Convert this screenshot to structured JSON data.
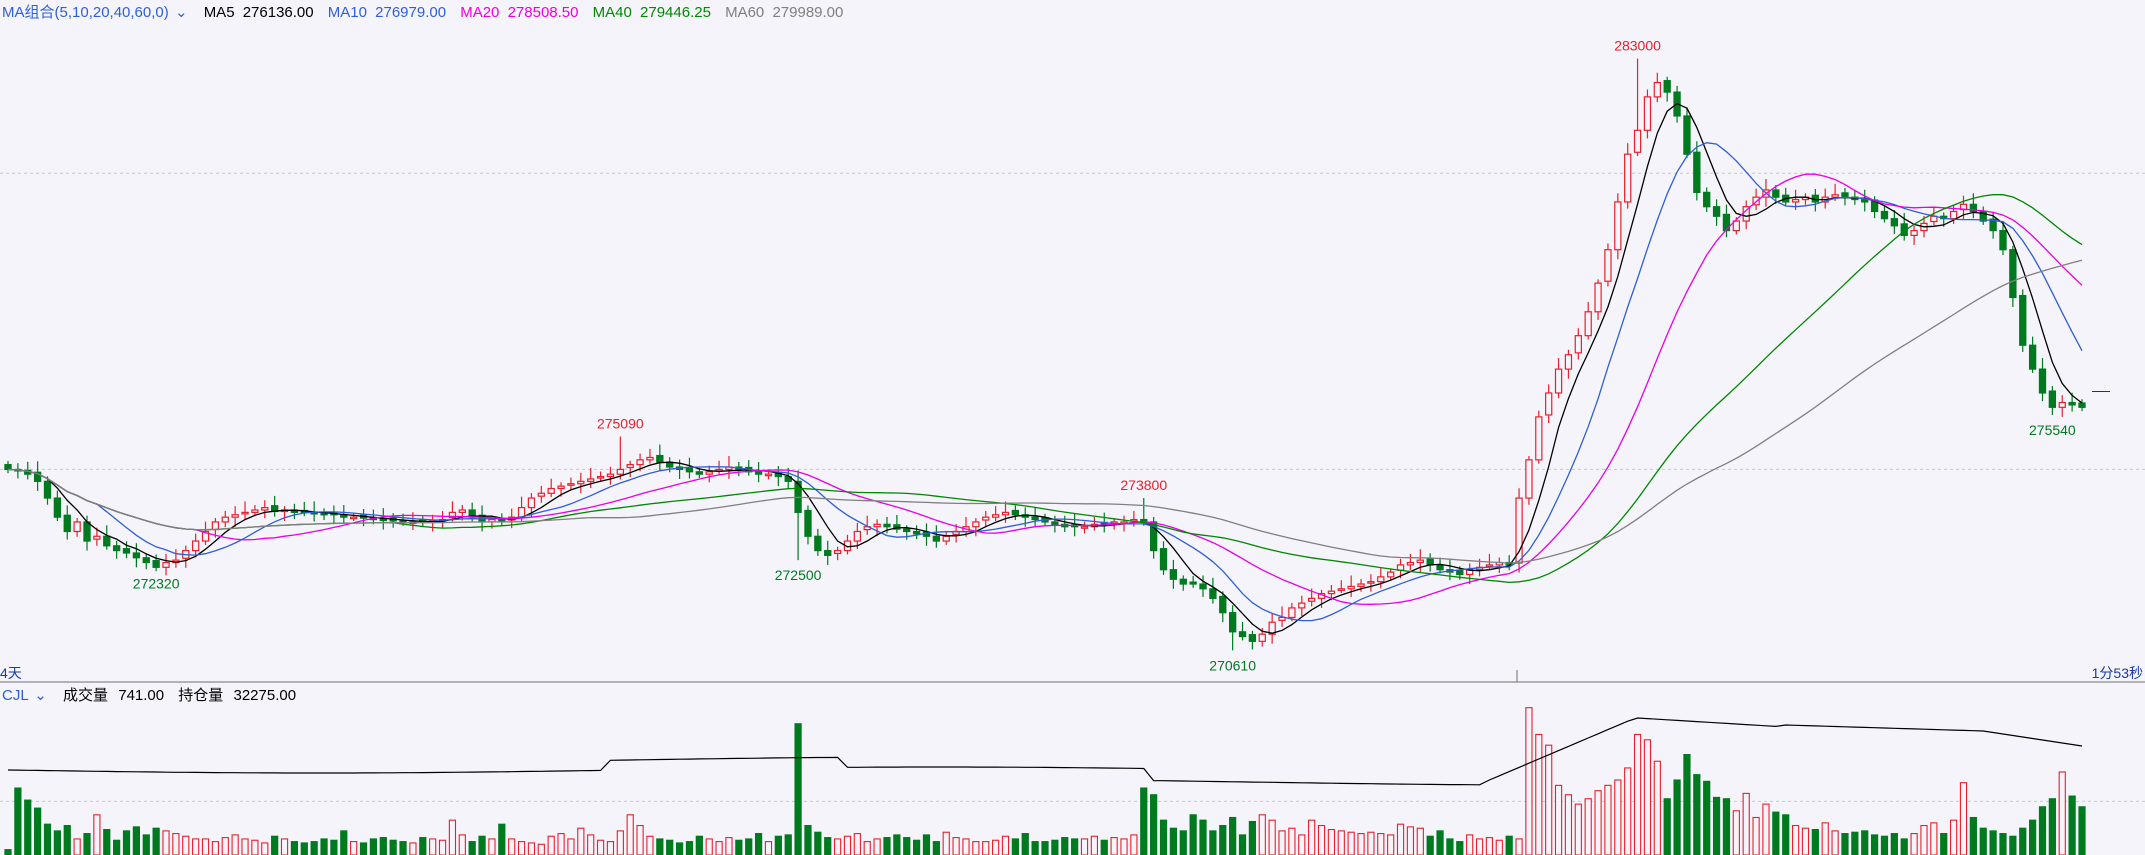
{
  "legend": {
    "ma_selector": "MA组合(5,10,20,40,60,0)",
    "items": [
      {
        "label": "MA5",
        "value": "276136.00",
        "color": "#000000"
      },
      {
        "label": "MA10",
        "value": "276979.00",
        "color": "#2f5fd8"
      },
      {
        "label": "MA20",
        "value": "278508.50",
        "color": "#e800e8"
      },
      {
        "label": "MA40",
        "value": "279446.25",
        "color": "#008800"
      },
      {
        "label": "MA60",
        "value": "279989.00",
        "color": "#808080"
      }
    ]
  },
  "axis": {
    "left_label": "4天",
    "right_label": "1分53秒"
  },
  "volume_legend": {
    "indicator": "CJL",
    "volume_label": "成交量",
    "volume_value": "741.00",
    "oi_label": "持仓量",
    "oi_value": "32275.00"
  },
  "colors": {
    "up": "#e8202a",
    "down": "#007a1f",
    "background": "#f4f4fa",
    "grid": "#c8c8c8"
  },
  "chart_data": {
    "type": "candlestick",
    "price_range": [
      270200,
      283600
    ],
    "annotations": [
      {
        "label": "275090",
        "value": 275090,
        "kind": "high",
        "index": 62,
        "color": "#e8202a"
      },
      {
        "label": "273800",
        "value": 273800,
        "kind": "high",
        "index": 115,
        "color": "#e8202a"
      },
      {
        "label": "283000",
        "value": 283000,
        "kind": "high",
        "index": 165,
        "color": "#e8202a"
      },
      {
        "label": "272320",
        "value": 272320,
        "kind": "low",
        "index": 15,
        "color": "#007a1f"
      },
      {
        "label": "272500",
        "value": 272500,
        "kind": "low",
        "index": 80,
        "color": "#007a1f"
      },
      {
        "label": "270610",
        "value": 270610,
        "kind": "low",
        "index": 124,
        "color": "#007a1f"
      },
      {
        "label": "275540",
        "value": 275540,
        "kind": "low",
        "index": 207,
        "color": "#007a1f"
      }
    ],
    "close": [
      274400,
      274380,
      274300,
      274150,
      273800,
      273400,
      273100,
      273300,
      272900,
      273000,
      272800,
      272700,
      272650,
      272550,
      272450,
      272350,
      272450,
      272500,
      272700,
      272900,
      273100,
      273300,
      273400,
      273450,
      273500,
      273550,
      273600,
      273520,
      273550,
      273500,
      273500,
      273480,
      273450,
      273450,
      273400,
      273400,
      273380,
      273360,
      273340,
      273320,
      273300,
      273300,
      273300,
      273320,
      273350,
      273500,
      273550,
      273400,
      273300,
      273350,
      273300,
      273400,
      273600,
      273800,
      273900,
      274000,
      274050,
      274100,
      274150,
      274200,
      274250,
      274300,
      274400,
      274500,
      274600,
      274650,
      274550,
      274450,
      274400,
      274350,
      274300,
      274350,
      274400,
      274450,
      274400,
      274350,
      274300,
      274300,
      274250,
      274150,
      273500,
      273000,
      272700,
      272600,
      272700,
      272900,
      273100,
      273200,
      273250,
      273200,
      273150,
      273100,
      273050,
      273000,
      272900,
      273000,
      273100,
      273200,
      273300,
      273400,
      273450,
      273500,
      273450,
      273400,
      273350,
      273300,
      273250,
      273200,
      273200,
      273200,
      273250,
      273250,
      273300,
      273300,
      273350,
      273300,
      272700,
      272300,
      272100,
      272000,
      272000,
      271900,
      271700,
      271400,
      271000,
      270900,
      270800,
      270950,
      271200,
      271300,
      271500,
      271600,
      271700,
      271800,
      271850,
      271900,
      271950,
      272000,
      272050,
      272150,
      272250,
      272400,
      272450,
      272500,
      272400,
      272300,
      272250,
      272200,
      272300,
      272350,
      272400,
      272450,
      272400,
      273800,
      274600,
      275500,
      276000,
      276500,
      276800,
      277200,
      277700,
      278300,
      279000,
      280000,
      281000,
      281500,
      282200,
      282500,
      282300,
      281800,
      281000,
      280200,
      279900,
      279700,
      279400,
      279600,
      279900,
      280100,
      280250,
      280100,
      280000,
      280050,
      280100,
      280000,
      280100,
      280150,
      280100,
      280050,
      280000,
      279800,
      279650,
      279500,
      279300,
      279400,
      279550,
      279700,
      279650,
      279800,
      279950,
      279800,
      279600,
      279400,
      279000,
      278000,
      277000,
      276500,
      276000,
      275700,
      275800,
      275750,
      275700
    ],
    "volume": [
      40,
      500,
      410,
      350,
      230,
      180,
      220,
      120,
      160,
      300,
      190,
      110,
      180,
      210,
      150,
      200,
      180,
      160,
      140,
      120,
      120,
      100,
      130,
      150,
      120,
      110,
      90,
      140,
      120,
      100,
      90,
      100,
      120,
      110,
      180,
      100,
      90,
      120,
      130,
      110,
      100,
      90,
      130,
      120,
      110,
      260,
      150,
      100,
      140,
      120,
      230,
      120,
      100,
      90,
      80,
      140,
      160,
      120,
      200,
      150,
      110,
      100,
      180,
      300,
      220,
      140,
      120,
      110,
      90,
      100,
      140,
      120,
      100,
      130,
      110,
      120,
      160,
      100,
      140,
      150,
      980,
      220,
      170,
      130,
      120,
      140,
      160,
      100,
      120,
      130,
      150,
      130,
      110,
      150,
      100,
      170,
      130,
      120,
      100,
      100,
      110,
      140,
      120,
      160,
      100,
      100,
      110,
      130,
      120,
      120,
      140,
      110,
      130,
      120,
      150,
      500,
      450,
      260,
      200,
      180,
      300,
      260,
      180,
      220,
      280,
      150,
      250,
      300,
      260,
      180,
      200,
      150,
      260,
      220,
      190,
      180,
      170,
      160,
      170,
      160,
      150,
      230,
      210,
      200,
      140,
      180,
      120,
      100,
      150,
      120,
      130,
      110,
      140,
      120,
      1100,
      900,
      820,
      520,
      450,
      380,
      420,
      480,
      520,
      560,
      650,
      900,
      860,
      700,
      420,
      560,
      750,
      600,
      550,
      430,
      420,
      330,
      460,
      280,
      380,
      320,
      300,
      220,
      200,
      190,
      240,
      180,
      160,
      170,
      180,
      150,
      140,
      160,
      120,
      160,
      220,
      240,
      160,
      260,
      540,
      280,
      200,
      180,
      160,
      140,
      200,
      260,
      360,
      420,
      620,
      440,
      360,
      300,
      220,
      180
    ]
  }
}
